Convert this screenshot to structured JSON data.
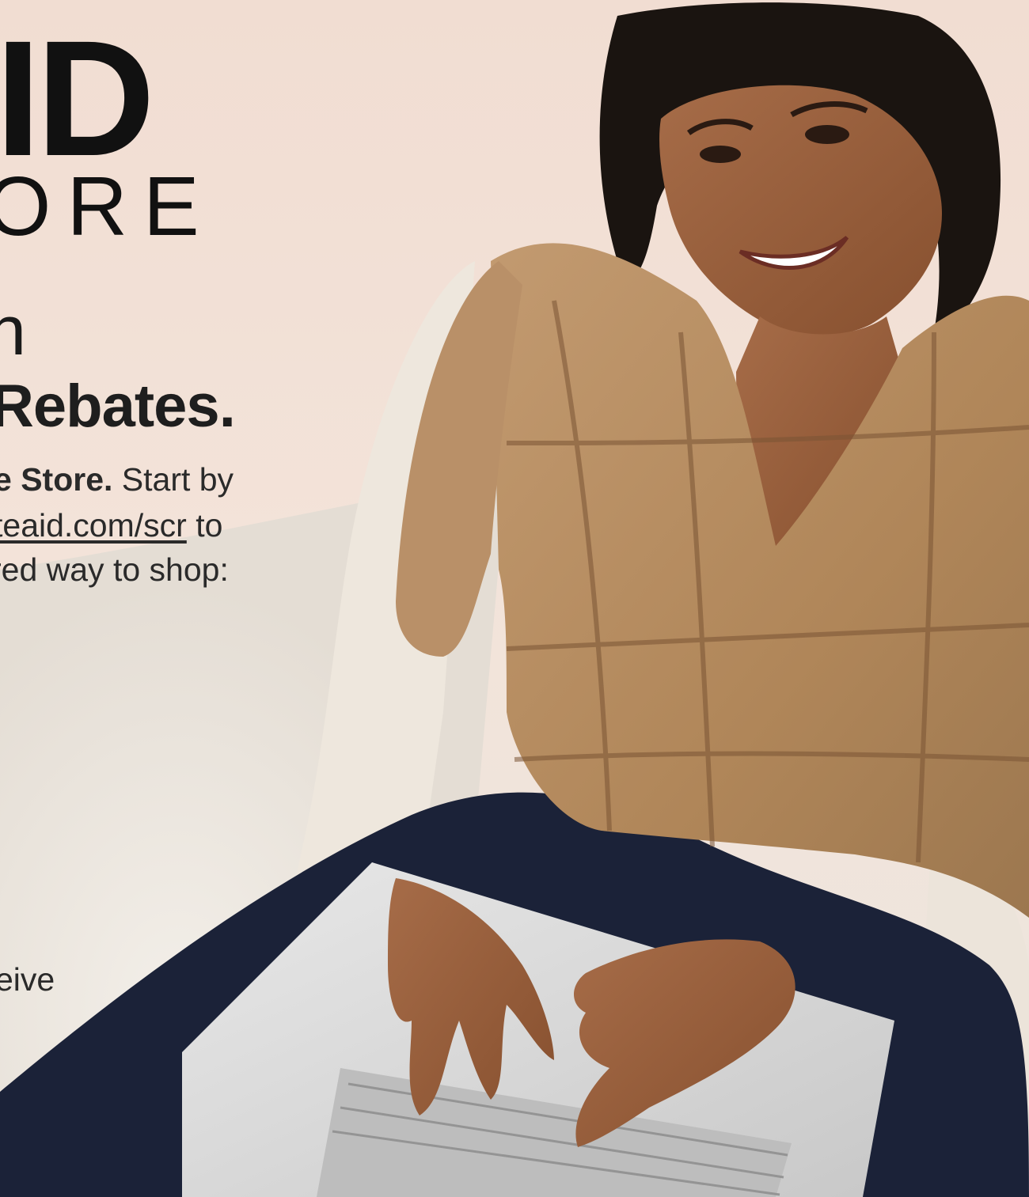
{
  "brand": {
    "logo_line1": "ID",
    "logo_line2": "ORE"
  },
  "headline": {
    "line1": "n",
    "line2": "Rebates."
  },
  "body": {
    "line1_bold": "e Store.",
    "line1_rest": " Start by",
    "line2_url": "teaid.com/scr",
    "line2_rest": " to",
    "line3": "red way to shop:",
    "line4": "eive"
  },
  "colors": {
    "background": "#efe0d6",
    "text": "#1a1a1a",
    "sweater": "#b58d62",
    "pants": "#1b2238",
    "laptop": "#dcdcdc"
  }
}
